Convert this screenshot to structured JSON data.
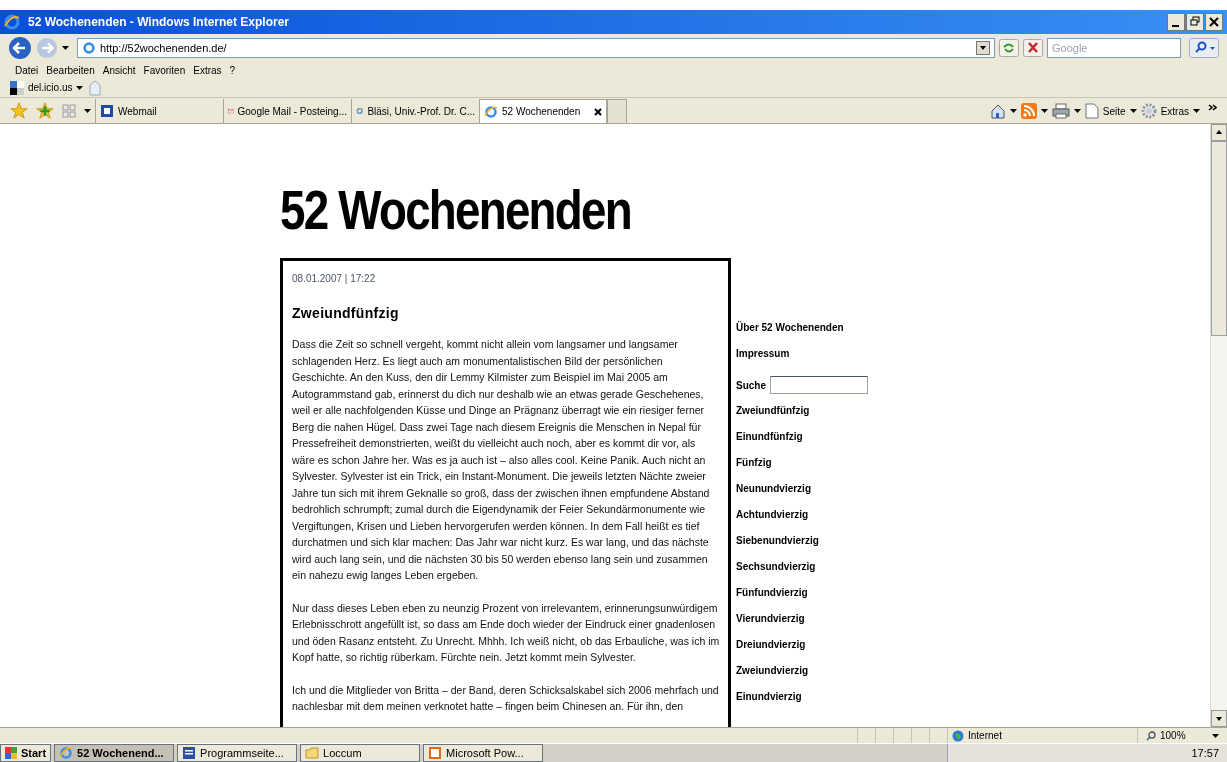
{
  "window": {
    "title": "52 Wochenenden - Windows Internet Explorer"
  },
  "address_bar": {
    "url": "http://52wochenenden.de/"
  },
  "search_box": {
    "placeholder": "Google"
  },
  "menu": [
    "Datei",
    "Bearbeiten",
    "Ansicht",
    "Favoriten",
    "Extras",
    "?"
  ],
  "links_bar": {
    "label": "del.icio.us"
  },
  "tabs": [
    {
      "label": "Webmail",
      "selected": false
    },
    {
      "label": "Google Mail - Posteing...",
      "selected": false
    },
    {
      "label": "Bläsi, Univ.-Prof. Dr. C...",
      "selected": false
    },
    {
      "label": "52 Wochenenden",
      "selected": true
    }
  ],
  "command_bar": [
    "Seite",
    "Extras"
  ],
  "page": {
    "site_title": "52 Wochenenden",
    "post": {
      "date": "08.01.2007 | 17:22",
      "title": "Zweiundfünfzig",
      "paragraphs": [
        [
          "Dass die Zeit so schnell vergeht, kommt nicht allein vom langsamer und langsamer",
          "schlagenden Herz. Es liegt auch am monumentalistischen Bild der persönlichen",
          "Geschichte. An den Kuss, den dir Lemmy Kilmister zum Beispiel im Mai 2005 am",
          "Autogrammstand gab, erinnerst du dich nur deshalb wie an etwas gerade Geschehenes,",
          "weil er alle nachfolgenden Küsse und Dinge an Prägnanz überragt wie ein riesiger ferner",
          "Berg die nahen Hügel. Dass zwei Tage nach diesem Ereignis die Menschen in Nepal für",
          "Pressefreiheit demonstrierten, weißt du vielleicht auch noch, aber es kommt dir vor, als",
          "wäre es schon Jahre her. Was es ja auch ist – also alles cool. Keine Panik. Auch nicht an",
          "Sylvester. Sylvester ist ein Trick, ein Instant-Monument. Die jeweils letzten Nächte zweier",
          "Jahre tun sich mit ihrem Geknalle so groß, dass der zwischen ihnen empfundene Abstand",
          "bedrohlich schrumpft; zumal durch die Eigendynamik der Feier Sekundärmonumente wie",
          "Vergiftungen, Krisen und Lieben hervorgerufen werden können. In dem Fall heißt es tief",
          "durchatmen und sich klar machen: Das Jahr war nicht kurz. Es war lang, und das nächste",
          "wird auch lang sein, und die nächsten 30 bis 50 werden ebenso lang sein und zusammen",
          "ein nahezu ewig langes Leben ergeben."
        ],
        [
          "Nur dass dieses Leben eben zu neunzig Prozent von irrelevantem, erinnerungsunwürdigem",
          "Erlebnisschrott angefüllt ist, so dass am Ende doch wieder der Eindruck einer gnadenlosen",
          "und öden Rasanz entsteht. Zu Unrecht. Mhhh. Ich weiß nicht, ob das Erbauliche, was ich im",
          "Kopf hatte, so richtig rüberkam. Fürchte nein. Jetzt kommt mein Sylvester."
        ],
        [
          "Ich und die Mitglieder von Britta – der Band, deren Schicksalskabel sich 2006 mehrfach und",
          "nachlesbar mit dem meinen verknotet hatte – fingen beim Chinesen an. Für ihn, den"
        ]
      ]
    },
    "sidebar": {
      "links_top": [
        "Über 52 Wochenenden",
        "Impressum"
      ],
      "search_label": "Suche",
      "posts": [
        "Zweiundfünfzig",
        "Einundfünfzig",
        "Fünfzig",
        "Neunundvierzig",
        "Achtundvierzig",
        "Siebenundvierzig",
        "Sechsundvierzig",
        "Fünfundvierzig",
        "Vierundvierzig",
        "Dreiundvierzig",
        "Zweiundvierzig",
        "Einundvierzig"
      ]
    }
  },
  "status_bar": {
    "zone": "Internet",
    "zoom": "100%"
  },
  "taskbar": {
    "start": "Start",
    "tasks": [
      {
        "label": "52 Wochenend...",
        "selected": true
      },
      {
        "label": "Programmseite...",
        "selected": false
      },
      {
        "label": "Loccum",
        "selected": false
      },
      {
        "label": "Microsoft Pow...",
        "selected": false
      }
    ],
    "clock": "17:57"
  }
}
